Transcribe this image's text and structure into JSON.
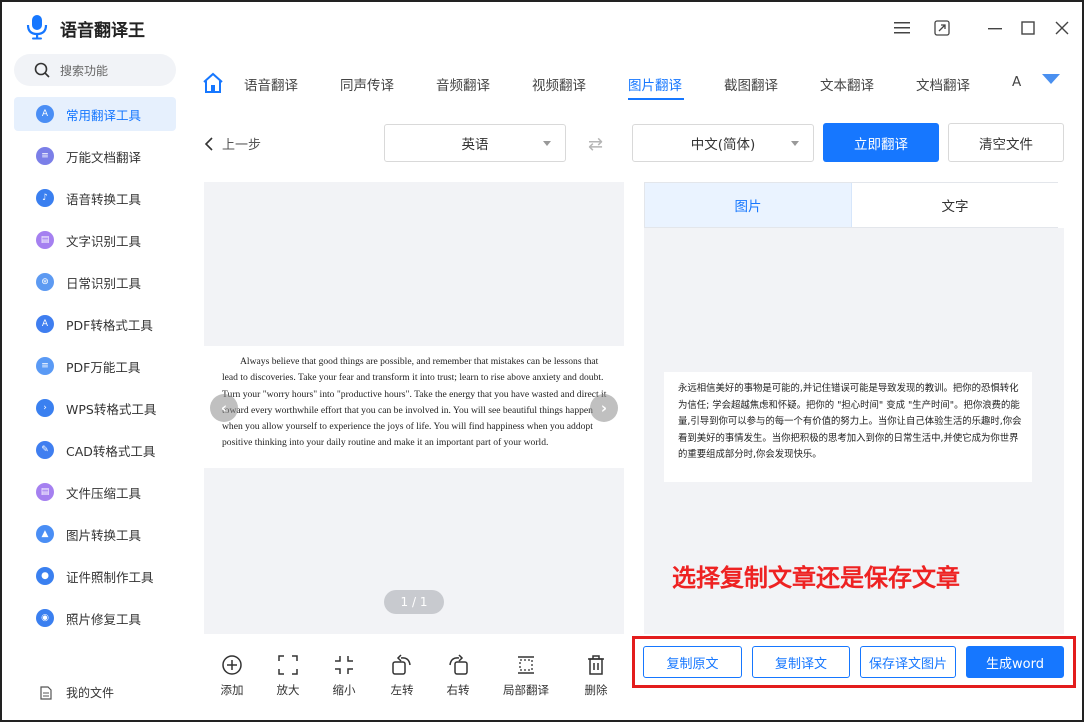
{
  "app": {
    "title": "语音翻译王"
  },
  "sidebar": {
    "search_placeholder": "搜索功能",
    "items": [
      {
        "label": "常用翻译工具",
        "icon": "translate-tool-icon",
        "color": "#4a8ef5",
        "active": true
      },
      {
        "label": "万能文档翻译",
        "icon": "document-translate-icon",
        "color": "#7b7fe8"
      },
      {
        "label": "语音转换工具",
        "icon": "voice-convert-icon",
        "color": "#3a7ff0"
      },
      {
        "label": "文字识别工具",
        "icon": "text-recognition-icon",
        "color": "#a580f0"
      },
      {
        "label": "日常识别工具",
        "icon": "daily-recognition-icon",
        "color": "#5d9af2"
      },
      {
        "label": "PDF转格式工具",
        "icon": "pdf-convert-icon",
        "color": "#3f7ef0"
      },
      {
        "label": "PDF万能工具",
        "icon": "pdf-tool-icon",
        "color": "#5a9af5"
      },
      {
        "label": "WPS转格式工具",
        "icon": "wps-convert-icon",
        "color": "#3a80f0"
      },
      {
        "label": "CAD转格式工具",
        "icon": "cad-convert-icon",
        "color": "#3f7ef0"
      },
      {
        "label": "文件压缩工具",
        "icon": "file-compress-icon",
        "color": "#a580f0"
      },
      {
        "label": "图片转换工具",
        "icon": "image-convert-icon",
        "color": "#4a8ef5"
      },
      {
        "label": "证件照制作工具",
        "icon": "id-photo-icon",
        "color": "#3a80f0"
      },
      {
        "label": "照片修复工具",
        "icon": "photo-repair-icon",
        "color": "#3a7ff0"
      }
    ],
    "my_files": "我的文件"
  },
  "tabs": [
    {
      "label": "语音翻译"
    },
    {
      "label": "同声传译"
    },
    {
      "label": "音频翻译"
    },
    {
      "label": "视频翻译"
    },
    {
      "label": "图片翻译",
      "active": true
    },
    {
      "label": "截图翻译"
    },
    {
      "label": "文本翻译"
    },
    {
      "label": "文档翻译"
    },
    {
      "label": "A"
    }
  ],
  "controls": {
    "back_label": "上一步",
    "source_lang": "英语",
    "target_lang": "中文(简体)",
    "translate_button": "立即翻译",
    "clear_button": "清空文件"
  },
  "source_document": {
    "text": "Always believe that good things are possible, and remember that mistakes can be lessons that lead to discoveries. Take your fear and transform it into trust; learn to rise above anxiety and doubt. Turn your \"worry hours\" into \"productive hours\". Take the energy that you have wasted and direct it toward every worthwhile effort that you can be involved in. You will see beautiful things happen when you allow yourself to experience the joys of life. You will find happiness when you addopt positive thinking into your daily routine and make it an important part of your world.",
    "pager": "1 / 1"
  },
  "toolbar": [
    {
      "label": "添加",
      "icon": "add-icon"
    },
    {
      "label": "放大",
      "icon": "zoom-in-icon"
    },
    {
      "label": "缩小",
      "icon": "zoom-out-icon"
    },
    {
      "label": "左转",
      "icon": "rotate-left-icon"
    },
    {
      "label": "右转",
      "icon": "rotate-right-icon"
    },
    {
      "label": "局部翻译",
      "icon": "partial-translate-icon"
    },
    {
      "label": "删除",
      "icon": "delete-icon"
    }
  ],
  "result": {
    "tab_image": "图片",
    "tab_text": "文字",
    "translated_text": "永远相信美好的事物是可能的,并记住错误可能是导致发现的教训。把你的恐惧转化为信任; 学会超越焦虑和怀疑。把你的 \"担心时间\" 变成 \"生产时间\"。把你浪费的能量,引导到你可以参与的每一个有价值的努力上。当你让自己体验生活的乐趣时,你会看到美好的事情发生。当你把积极的思考加入到你的日常生活中,并使它成为你世界的重要组成部分时,你会发现快乐。",
    "hint": "选择复制文章还是保存文章"
  },
  "actions": {
    "copy_source": "复制原文",
    "copy_translation": "复制译文",
    "save_image": "保存译文图片",
    "generate_word": "生成word"
  },
  "colors": {
    "accent": "#1677ff",
    "highlight": "#e31d1d"
  }
}
